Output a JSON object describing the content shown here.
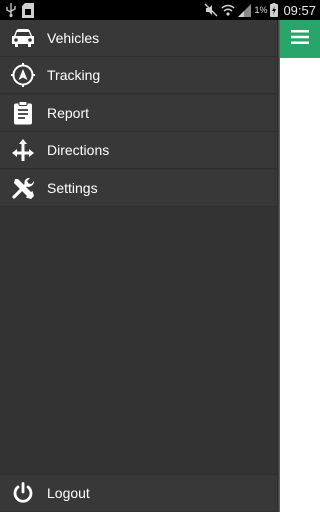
{
  "status_bar": {
    "battery_percent": "1%",
    "time": "09:57",
    "icons": [
      "usb-icon",
      "sd-card-icon",
      "mute-icon",
      "wifi-icon",
      "signal-icon",
      "charging-icon"
    ]
  },
  "drawer": {
    "items": [
      {
        "label": "Vehicles",
        "icon": "car-icon"
      },
      {
        "label": "Tracking",
        "icon": "navigation-icon"
      },
      {
        "label": "Report",
        "icon": "clipboard-icon"
      },
      {
        "label": "Directions",
        "icon": "directions-icon"
      },
      {
        "label": "Settings",
        "icon": "tools-icon"
      }
    ],
    "logout": {
      "label": "Logout",
      "icon": "power-icon"
    }
  },
  "colors": {
    "drawer_bg": "#333333",
    "item_bg": "#383838",
    "accent": "#27a56b"
  },
  "header": {
    "menu_icon": "hamburger-icon"
  }
}
